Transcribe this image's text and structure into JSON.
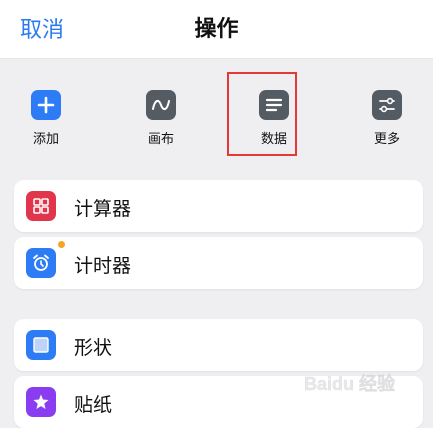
{
  "header": {
    "cancel_label": "取消",
    "title": "操作"
  },
  "actions": [
    {
      "label": "添加",
      "icon": "plus-icon"
    },
    {
      "label": "画布",
      "icon": "wave-icon"
    },
    {
      "label": "数据",
      "icon": "text-lines-icon"
    },
    {
      "label": "更多",
      "icon": "sliders-icon"
    }
  ],
  "list": [
    {
      "label": "计算器",
      "icon": "calculator-icon",
      "color": "#e0354a"
    },
    {
      "label": "计时器",
      "icon": "alarm-clock-icon",
      "color": "#2d7cf6",
      "badge_color": "#f4a522"
    },
    {
      "label": "形状",
      "icon": "square-shape-icon",
      "color": "#2d7cf6"
    },
    {
      "label": "贴纸",
      "icon": "sticker-star-icon",
      "color": "#8a3df0"
    }
  ],
  "colors": {
    "accent": "#2b7bf0",
    "highlight": "#e53935"
  },
  "watermark": {
    "text": "Baidu 经验"
  }
}
